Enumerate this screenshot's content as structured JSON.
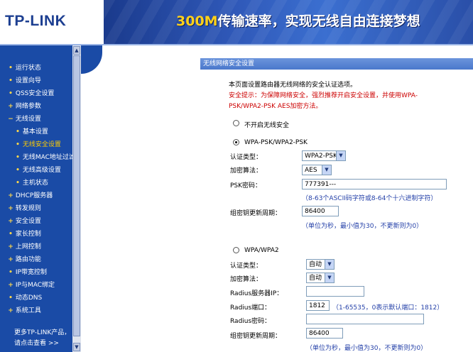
{
  "header": {
    "logo": "TP-LINK",
    "slogan_highlight": "300M",
    "slogan_rest": "传输速率，实现无线自由连接梦想"
  },
  "sidebar": {
    "items": [
      {
        "label": "运行状态",
        "marker": "•"
      },
      {
        "label": "设置向导",
        "marker": "•"
      },
      {
        "label": "QSS安全设置",
        "marker": "•"
      },
      {
        "label": "网络参数",
        "marker": "+"
      },
      {
        "label": "无线设置",
        "marker": "−"
      },
      {
        "label": "基本设置",
        "marker": "•"
      },
      {
        "label": "无线安全设置",
        "marker": "•"
      },
      {
        "label": "无线MAC地址过滤",
        "marker": "•"
      },
      {
        "label": "无线高级设置",
        "marker": "•"
      },
      {
        "label": "主机状态",
        "marker": "•"
      },
      {
        "label": "DHCP服务器",
        "marker": "+"
      },
      {
        "label": "转发规则",
        "marker": "+"
      },
      {
        "label": "安全设置",
        "marker": "+"
      },
      {
        "label": "家长控制",
        "marker": "•"
      },
      {
        "label": "上网控制",
        "marker": "+"
      },
      {
        "label": "路由功能",
        "marker": "+"
      },
      {
        "label": "IP带宽控制",
        "marker": "•"
      },
      {
        "label": "IP与MAC绑定",
        "marker": "+"
      },
      {
        "label": "动态DNS",
        "marker": "•"
      },
      {
        "label": "系统工具",
        "marker": "+"
      }
    ],
    "more_line1": "更多TP-LINK产品，",
    "more_line2": "请点击查看 >>"
  },
  "panel": {
    "title": "无线网络安全设置",
    "intro": "本页面设置路由器无线网络的安全认证选项。",
    "tip_line1": "安全提示：为保障网络安全，强烈推荐开启安全设置，并使用WPA-",
    "tip_line2": "PSK/WPA2-PSK AES加密方法。",
    "opt_disable": "不开启无线安全",
    "opt_psk": "WPA-PSK/WPA2-PSK",
    "auth_label": "认证类型：",
    "auth_value": "WPA2-PSK",
    "enc_label": "加密算法：",
    "enc_value": "AES",
    "psk_label": "PSK密码：",
    "psk_value": "777391---",
    "psk_hint": "（8-63个ASCII码字符或8-64个十六进制字符）",
    "renew_label": "组密钥更新周期：",
    "renew_value": "86400",
    "renew_hint": "（单位为秒，最小值为30，不更新则为0）",
    "opt_wpa": "WPA/WPA2",
    "auth2_label": "认证类型：",
    "auth2_value": "自动",
    "enc2_label": "加密算法：",
    "enc2_value": "自动",
    "radius_ip_label": "Radius服务器IP：",
    "radius_ip_value": "",
    "radius_port_label": "Radius端口：",
    "radius_port_value": "1812",
    "radius_port_hint": "（1-65535，0表示默认端口：1812）",
    "radius_pwd_label": "Radius密码：",
    "radius_pwd_value": "",
    "renew2_label": "组密钥更新周期：",
    "renew2_value": "86400",
    "renew2_hint": "（单位为秒，最小值为30，不更新则为0）"
  }
}
